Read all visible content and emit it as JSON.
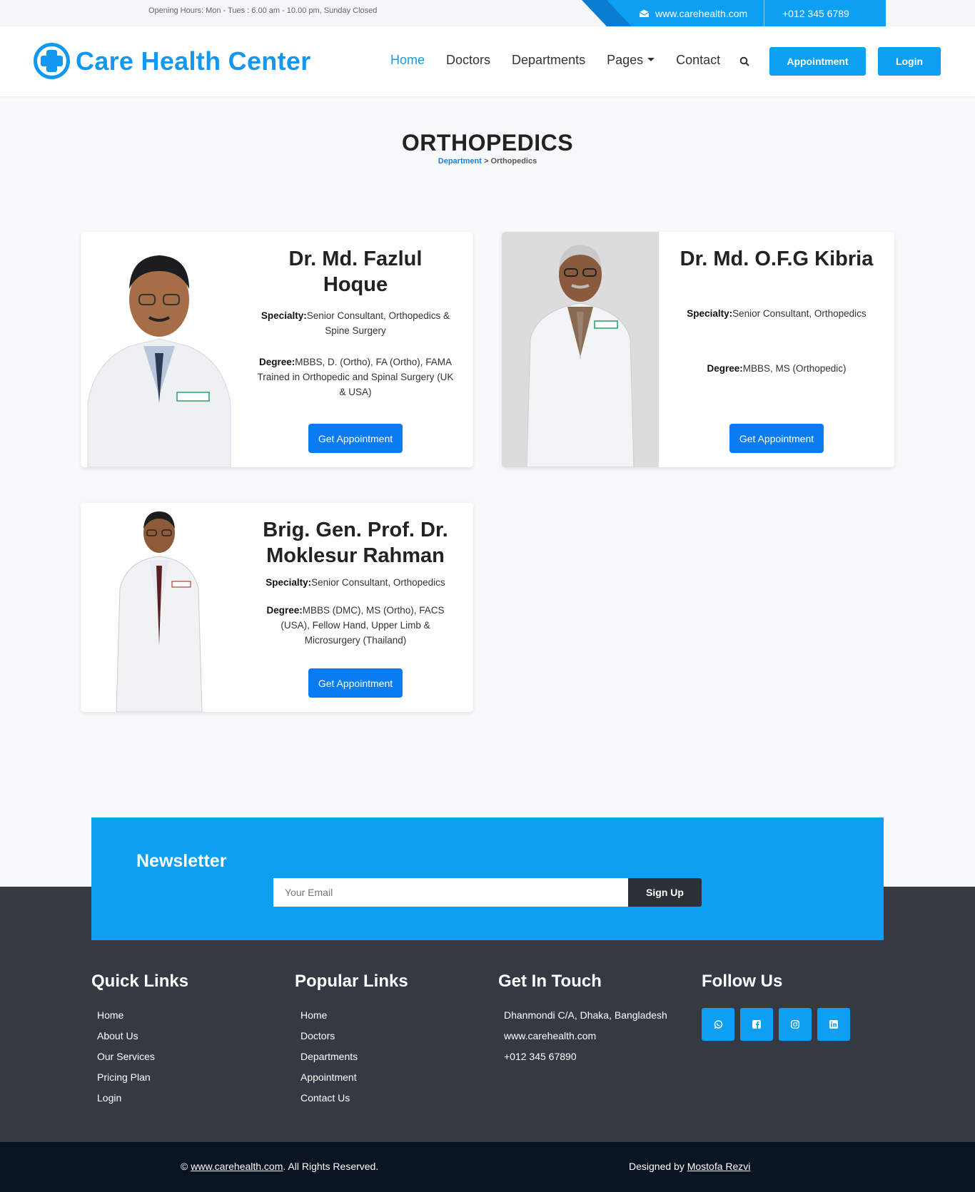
{
  "topbar": {
    "hours": "Opening Hours: Mon - Tues : 6.00 am - 10.00 pm, Sunday Closed",
    "site": "www.carehealth.com",
    "phone": "+012 345 6789"
  },
  "header": {
    "logo_text": "Care Health Center",
    "nav": [
      "Home",
      "Doctors",
      "Departments",
      "Pages",
      "Contact"
    ],
    "appointment_label": "Appointment",
    "login_label": "Login"
  },
  "page": {
    "title": "ORTHOPEDICS",
    "breadcrumb_link": "Department",
    "breadcrumb_sep": " > ",
    "breadcrumb_current": "Orthopedics"
  },
  "doctors": [
    {
      "name": "Dr. Md. Fazlul Hoque",
      "specialty_label": "Specialty:",
      "specialty": "Senior Consultant, Orthopedics & Spine Surgery",
      "degree_label": "Degree:",
      "degree": "MBBS, D. (Ortho), FA (Ortho), FAMA Trained in Orthopedic and Spinal Surgery (UK & USA)",
      "button": "Get Appointment"
    },
    {
      "name": "Dr. Md. O.F.G Kibria",
      "specialty_label": "Specialty:",
      "specialty": "Senior Consultant, Orthopedics",
      "degree_label": "Degree:",
      "degree": "MBBS, MS (Orthopedic)",
      "button": "Get Appointment"
    },
    {
      "name": "Brig. Gen. Prof. Dr. Moklesur Rahman",
      "specialty_label": "Specialty:",
      "specialty": "Senior Consultant, Orthopedics",
      "degree_label": "Degree:",
      "degree": "MBBS (DMC), MS (Ortho), FACS (USA), Fellow Hand, Upper Limb & Microsurgery (Thailand)",
      "button": "Get Appointment"
    }
  ],
  "newsletter": {
    "title": "Newsletter",
    "placeholder": "Your Email",
    "button": "Sign Up"
  },
  "footer": {
    "quick_links": {
      "title": "Quick Links",
      "items": [
        "Home",
        "About Us",
        "Our Services",
        "Pricing Plan",
        "Login"
      ]
    },
    "popular_links": {
      "title": "Popular Links",
      "items": [
        "Home",
        "Doctors",
        "Departments",
        "Appointment",
        "Contact Us"
      ]
    },
    "get_in_touch": {
      "title": "Get In Touch",
      "items": [
        "Dhanmondi C/A, Dhaka, Bangladesh",
        "www.carehealth.com",
        "+012 345 67890"
      ]
    },
    "follow_us": {
      "title": "Follow Us",
      "icons": [
        "whatsapp-icon",
        "facebook-icon",
        "instagram-icon",
        "linkedin-icon"
      ]
    }
  },
  "bottombar": {
    "copy_prefix": "© ",
    "copy_link": "www.carehealth.com",
    "copy_suffix": ". All Rights Reserved.",
    "designed_prefix": "Designed by ",
    "designed_link": "Mostofa Rezvi"
  },
  "colors": {
    "primary": "#0d9ff1",
    "button_blue": "#0a7cf2",
    "footer": "#353941",
    "bottom": "#0a1322"
  }
}
